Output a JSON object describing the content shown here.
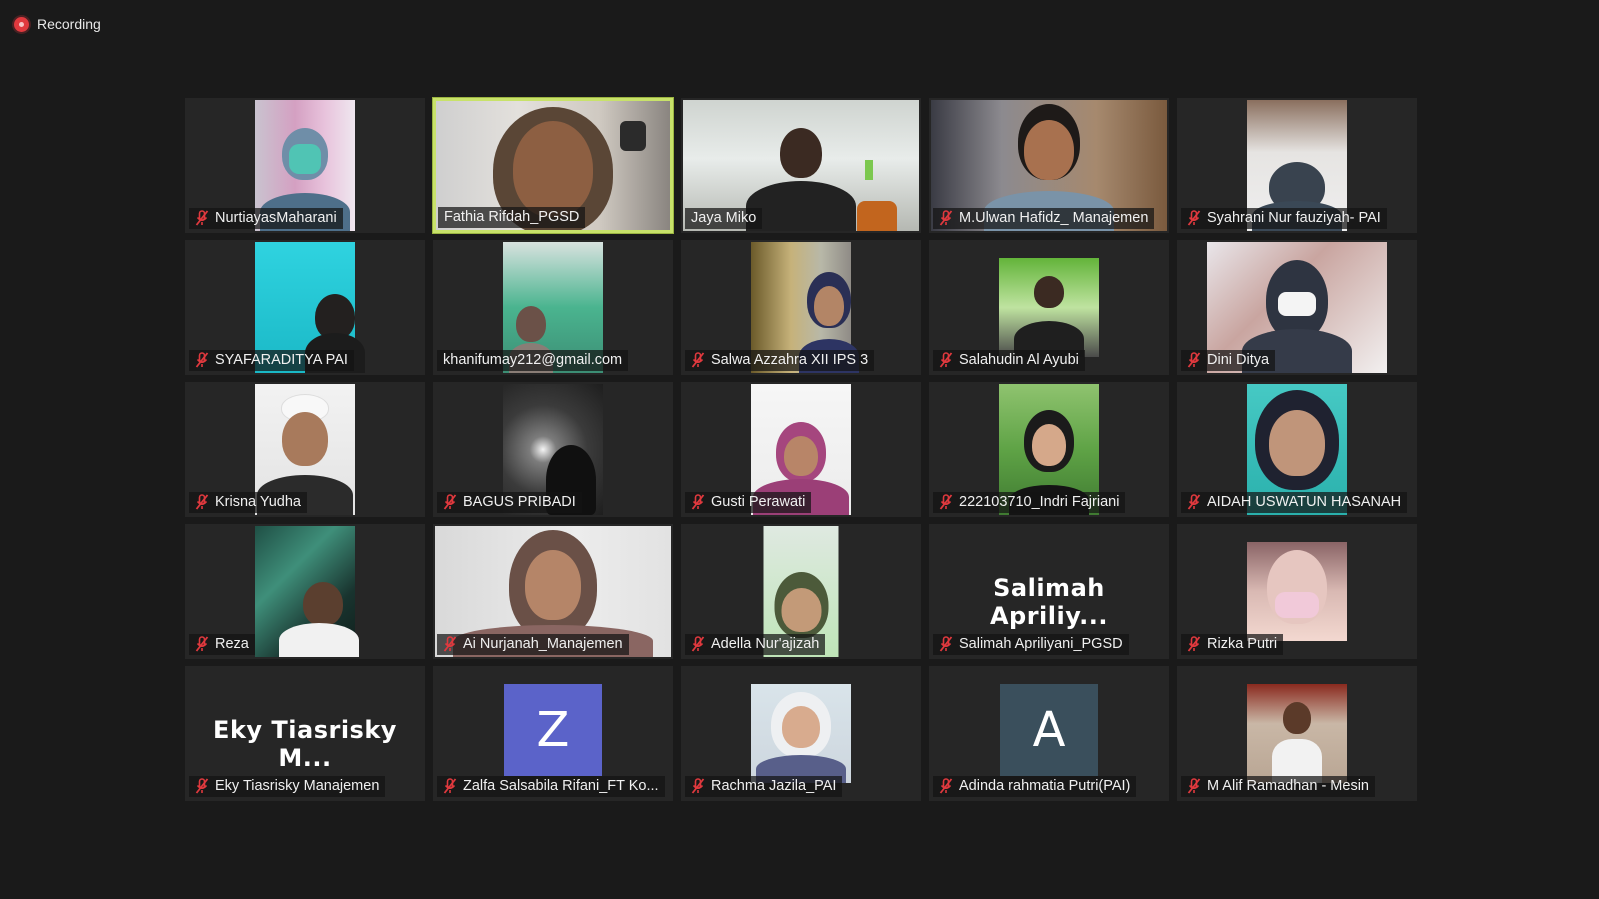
{
  "recording": {
    "label": "Recording"
  },
  "participants": [
    {
      "name": "NurtiayasMaharani",
      "muted": true
    },
    {
      "name": "Fathia Rifdah_PGSD",
      "muted": false,
      "active_speaker": true
    },
    {
      "name": "Jaya Miko",
      "muted": false
    },
    {
      "name": "M.Ulwan Hafidz_ Manajemen",
      "muted": true
    },
    {
      "name": "Syahrani Nur fauziyah- PAI",
      "muted": true
    },
    {
      "name": "SYAFARADITYA PAI",
      "muted": true
    },
    {
      "name": "khanifumay212@gmail.com",
      "muted": false
    },
    {
      "name": "Salwa Azzahra XII IPS 3",
      "muted": true
    },
    {
      "name": "Salahudin Al Ayubi",
      "muted": true
    },
    {
      "name": "Dini Ditya",
      "muted": true
    },
    {
      "name": "Krisna Yudha",
      "muted": true
    },
    {
      "name": "BAGUS PRIBADI",
      "muted": true
    },
    {
      "name": "Gusti Perawati",
      "muted": true
    },
    {
      "name": "222103710_Indri Fajriani",
      "muted": true
    },
    {
      "name": "AIDAH USWATUN HASANAH",
      "muted": true
    },
    {
      "name": "Reza",
      "muted": true
    },
    {
      "name": "Ai Nurjanah_Manajemen",
      "muted": true
    },
    {
      "name": "Adella Nur'ajizah",
      "muted": true
    },
    {
      "name": "Salimah Apriliyani_PGSD",
      "muted": true,
      "display_text": "Salimah Apriliy..."
    },
    {
      "name": "Rizka Putri",
      "muted": true
    },
    {
      "name": "Eky Tiasrisky Manajemen",
      "muted": true,
      "display_text": "Eky Tiasrisky M..."
    },
    {
      "name": "Zalfa Salsabila Rifani_FT Ko...",
      "muted": true,
      "avatar_letter": "Z",
      "avatar_color": "#5b63c9"
    },
    {
      "name": "Rachma Jazila_PAI",
      "muted": true
    },
    {
      "name": "Adinda rahmatia Putri(PAI)",
      "muted": true,
      "avatar_letter": "A",
      "avatar_color": "#3a4f5c"
    },
    {
      "name": "M Alif Ramadhan - Mesin",
      "muted": true
    }
  ],
  "colors": {
    "background": "#1a1a1a",
    "tile": "#262626",
    "active_border": "#c8e26a",
    "muted_icon": "#e0393e",
    "recording_dot": "#e0393e"
  }
}
